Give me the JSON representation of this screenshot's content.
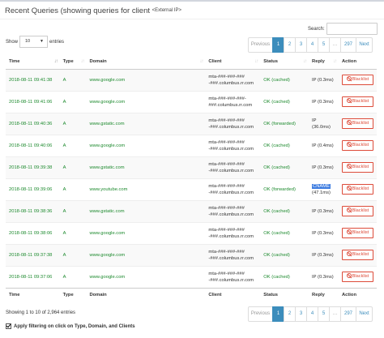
{
  "header": {
    "title": "Recent Queries (showing queries for client",
    "client_tag": "<External IP>"
  },
  "search": {
    "label": "Search:",
    "value": ""
  },
  "length": {
    "show_label": "Show",
    "selected": "10",
    "entries_label": "entries"
  },
  "pagination": [
    "Previous",
    "1",
    "2",
    "3",
    "4",
    "5",
    "…",
    "297",
    "Next"
  ],
  "table": {
    "columns": [
      "Time",
      "Type",
      "Domain",
      "Client",
      "Status",
      "Reply",
      "Action"
    ],
    "rows": [
      {
        "time": "2018-08-11 09:41:38",
        "type": "A",
        "domain": "www.google.com",
        "client1": "mta-###-###-###",
        "client2": "-###.columbus.rr.com",
        "status": "OK (cached)",
        "reply1": "IP (0.3ms)",
        "reply2": "",
        "action": "Blacklist"
      },
      {
        "time": "2018-08-11 09:41:06",
        "type": "A",
        "domain": "www.google.com",
        "client1": "mta-###-###-###-",
        "client2": "###.columbus.rr.com",
        "status": "OK (cached)",
        "reply1": "IP (0.3ms)",
        "reply2": "",
        "action": "Blacklist"
      },
      {
        "time": "2018-08-11 09:40:36",
        "type": "A",
        "domain": "www.gstatic.com",
        "client1": "mta-###-###-###",
        "client2": "-###.columbus.rr.com",
        "status": "OK (forwarded)",
        "reply1": "IP",
        "reply2": "(36.0ms)",
        "action": "Blacklist"
      },
      {
        "time": "2018-08-11 09:40:06",
        "type": "A",
        "domain": "www.google.com",
        "client1": "mta-###-###-###",
        "client2": "-###.columbus.rr.com",
        "status": "OK (cached)",
        "reply1": "IP (0.4ms)",
        "reply2": "",
        "action": "Blacklist"
      },
      {
        "time": "2018-08-11 09:39:38",
        "type": "A",
        "domain": "www.gstatic.com",
        "client1": "mta-###-###-###",
        "client2": "-###.columbus.rr.com",
        "status": "OK (cached)",
        "reply1": "IP (0.3ms)",
        "reply2": "",
        "action": "Blacklist"
      },
      {
        "time": "2018-08-11 09:39:06",
        "type": "A",
        "domain": "www.youtube.com",
        "client1": "mta-###-###-###",
        "client2": "-###.columbus.rr.com",
        "status": "OK (forwarded)",
        "reply1": "CNAME",
        "reply2": "(47.1ms)",
        "action": "Blacklist"
      },
      {
        "time": "2018-08-11 09:38:36",
        "type": "A",
        "domain": "www.gstatic.com",
        "client1": "mta-###-###-###",
        "client2": "-###.columbus.rr.com",
        "status": "OK (cached)",
        "reply1": "IP (0.3ms)",
        "reply2": "",
        "action": "Blacklist"
      },
      {
        "time": "2018-08-11 09:38:06",
        "type": "A",
        "domain": "www.google.com",
        "client1": "mta-###-###-###",
        "client2": "-###.columbus.rr.com",
        "status": "OK (cached)",
        "reply1": "IP (0.3ms)",
        "reply2": "",
        "action": "Blacklist"
      },
      {
        "time": "2018-08-11 09:37:38",
        "type": "A",
        "domain": "www.google.com",
        "client1": "mta-###-###-###",
        "client2": "-###.columbus.rr.com",
        "status": "OK (cached)",
        "reply1": "IP (0.3ms)",
        "reply2": "",
        "action": "Blacklist"
      },
      {
        "time": "2018-08-11 09:37:06",
        "type": "A",
        "domain": "www.google.com",
        "client1": "mta-###-###-###",
        "client2": "-###.columbus.rr.com",
        "status": "OK (cached)",
        "reply1": "IP (0.3ms)",
        "reply2": "",
        "action": "Blacklist"
      }
    ]
  },
  "footer": {
    "info": "Showing 1 to 10 of 2,964 entries",
    "apply_filtering_label": "Apply filtering on click on Type, Domain, and Clients"
  },
  "colors": {
    "accent": "#3c8dbc",
    "ok_green": "#1d8a2e",
    "blacklist_red": "#dd4b39",
    "cname_highlight": "#3d7ce0"
  }
}
